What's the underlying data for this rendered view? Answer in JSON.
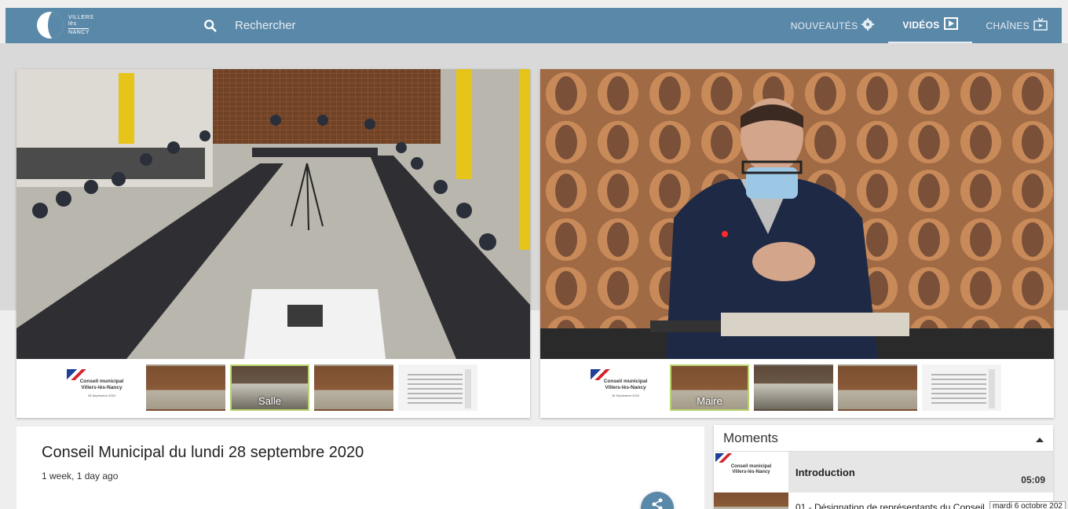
{
  "header": {
    "logo_line1": "VILLERS",
    "logo_line2": "lès",
    "logo_line3": "NANCY",
    "search_placeholder": "Rechercher",
    "nav": [
      {
        "label": "NOUVEAUTÉS",
        "icon": "gear-badge-icon",
        "active": false
      },
      {
        "label": "VIDÉOS",
        "icon": "play-box-icon",
        "active": true
      },
      {
        "label": "CHAÎNES",
        "icon": "tv-icon",
        "active": false
      }
    ]
  },
  "left_player": {
    "thumbnails": [
      {
        "type": "title",
        "title1": "Conseil municipal",
        "title2": "Villers-lès-Nancy",
        "date": "28 Septembre 2020"
      },
      {
        "type": "room",
        "label": ""
      },
      {
        "type": "hall",
        "label": "Salle",
        "active": true
      },
      {
        "type": "room",
        "label": ""
      },
      {
        "type": "doc",
        "label": ""
      }
    ]
  },
  "right_player": {
    "thumbnails": [
      {
        "type": "title",
        "title1": "Conseil municipal",
        "title2": "Villers-lès-Nancy",
        "date": "28 Septembre 2020"
      },
      {
        "type": "room",
        "label": "Maire",
        "active": true
      },
      {
        "type": "hall",
        "label": ""
      },
      {
        "type": "room",
        "label": ""
      },
      {
        "type": "doc",
        "label": ""
      }
    ]
  },
  "video": {
    "title": "Conseil Municipal du lundi 28 septembre 2020",
    "age": "1 week, 1 day ago"
  },
  "moments": {
    "heading": "Moments",
    "items": [
      {
        "title": "Introduction",
        "time": "05:09"
      },
      {
        "title": "01 - Désignation de représentants du Conseil",
        "time": ""
      }
    ]
  },
  "tooltip": "mardi 6 octobre 202"
}
